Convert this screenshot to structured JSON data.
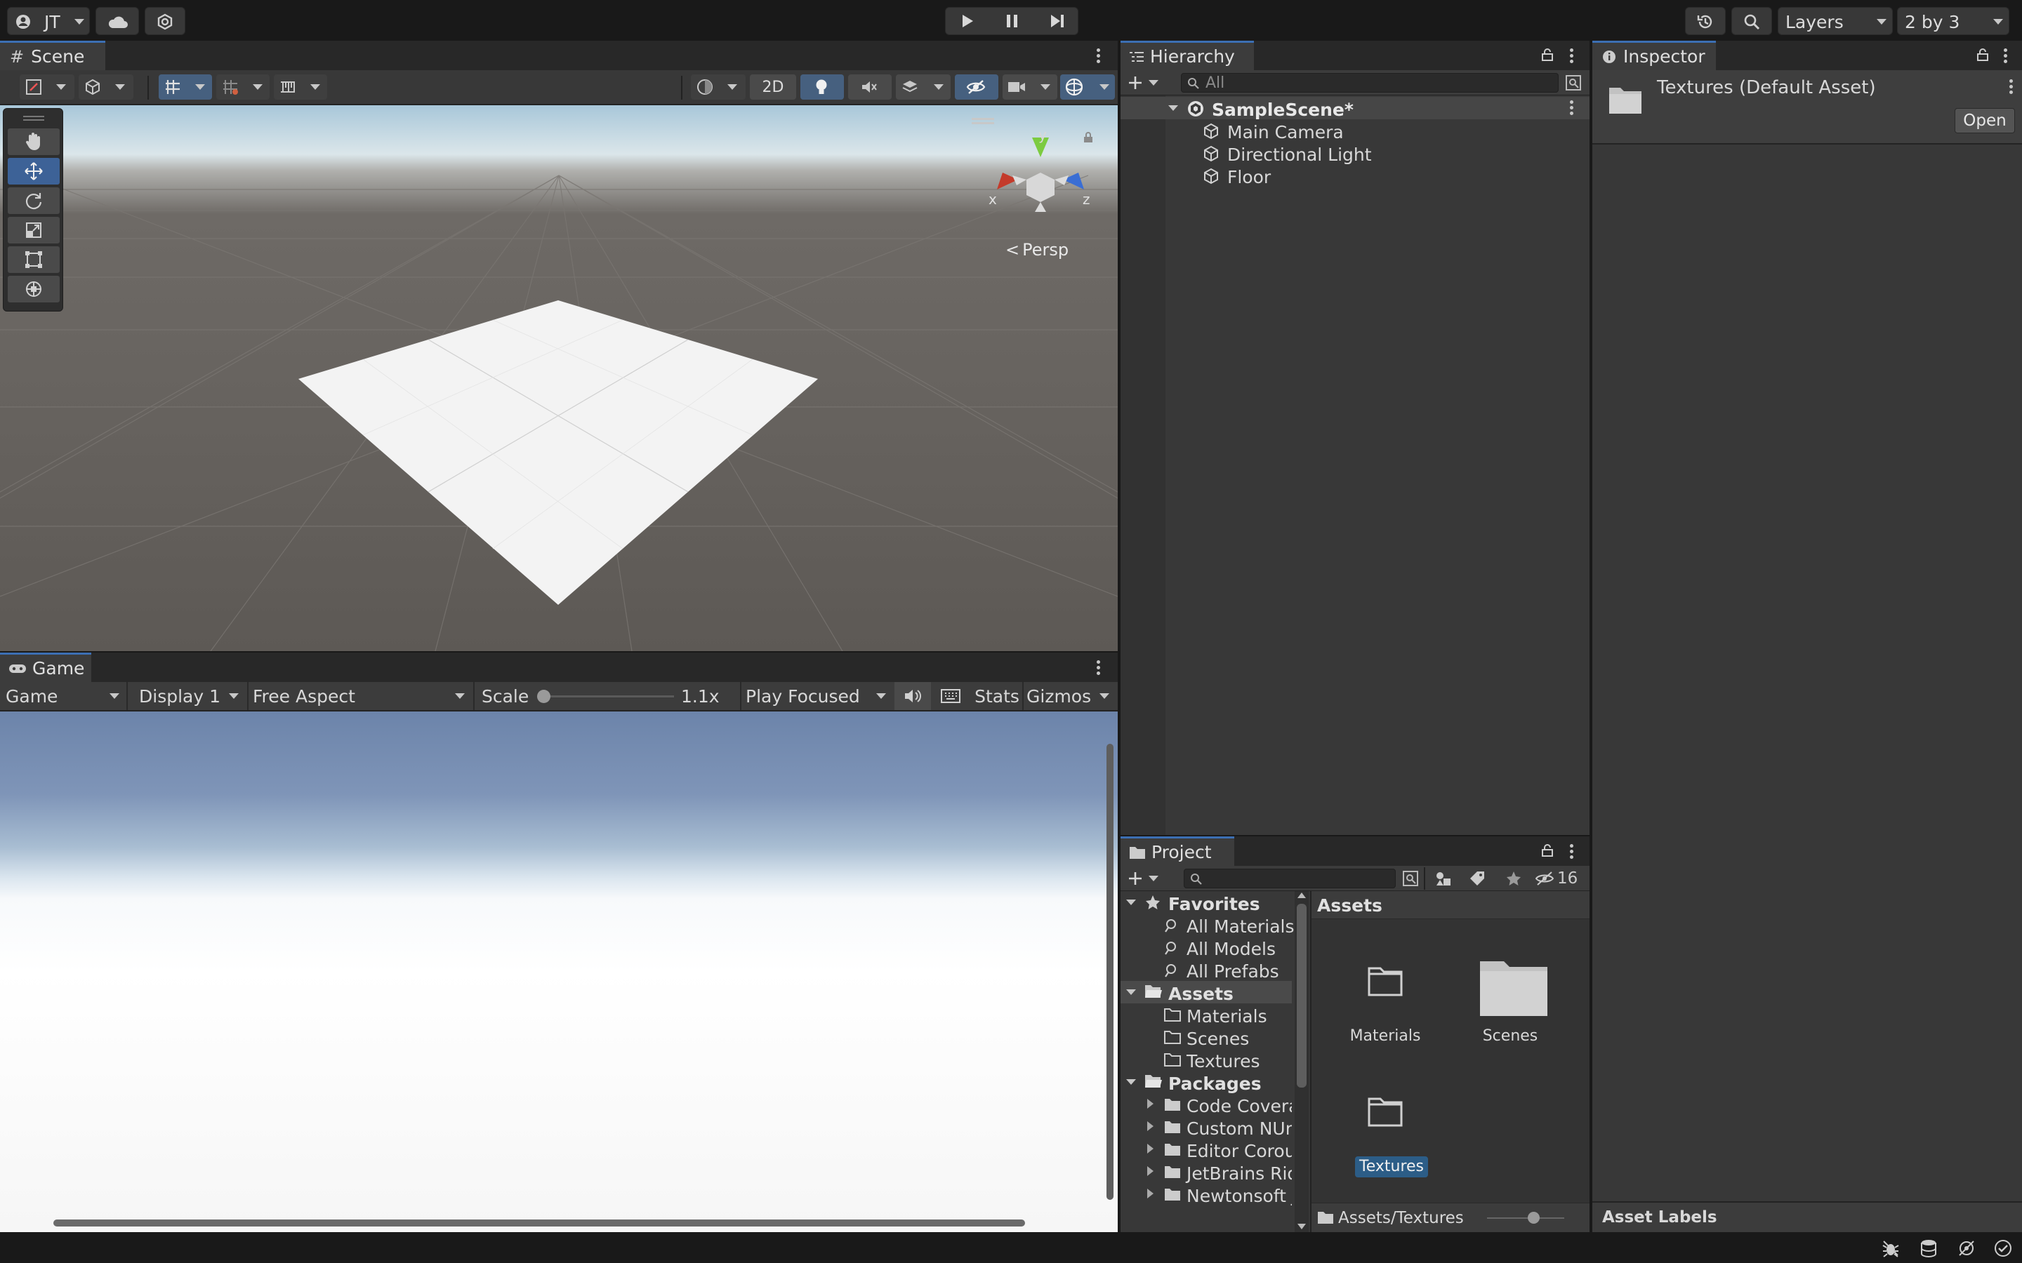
{
  "toolbar": {
    "account": "JT",
    "layers": "Layers",
    "layout": "2 by 3"
  },
  "scene": {
    "tab": "Scene",
    "mode_2d": "2D",
    "persp": "Persp",
    "axis_x": "x",
    "axis_y": "y",
    "axis_z": "z"
  },
  "game": {
    "tab": "Game",
    "view_select": "Game",
    "display": "Display 1",
    "aspect": "Free Aspect",
    "scale_label": "Scale",
    "scale_value": "1.1x",
    "play_mode": "Play Focused",
    "stats": "Stats",
    "gizmos": "Gizmos",
    "scale_fraction": 0.02
  },
  "hierarchy": {
    "tab": "Hierarchy",
    "search_placeholder": "All",
    "scene": "SampleScene*",
    "items": [
      "Main Camera",
      "Directional Light",
      "Floor"
    ]
  },
  "inspector": {
    "tab": "Inspector",
    "title": "Textures (Default Asset)",
    "open_button": "Open",
    "asset_labels": "Asset Labels"
  },
  "project": {
    "tab": "Project",
    "hidden_count": "16",
    "favorites": "Favorites",
    "favorite_items": [
      "All Materials",
      "All Models",
      "All Prefabs"
    ],
    "assets": "Assets",
    "asset_folders": [
      "Materials",
      "Scenes",
      "Textures"
    ],
    "packages": "Packages",
    "package_items": [
      "Code Covera",
      "Custom NUni",
      "Editor Corout",
      "JetBrains Rid",
      "Newtonsoft J"
    ],
    "breadcrumb": "Assets",
    "grid_items": [
      "Materials",
      "Scenes",
      "Textures"
    ],
    "footer_path": "Assets/Textures",
    "icon_size_fraction": 0.6
  },
  "colors": {
    "accent": "#3c6fb3",
    "selection": "#2c5d87",
    "panel": "#383838",
    "background": "#191919"
  }
}
